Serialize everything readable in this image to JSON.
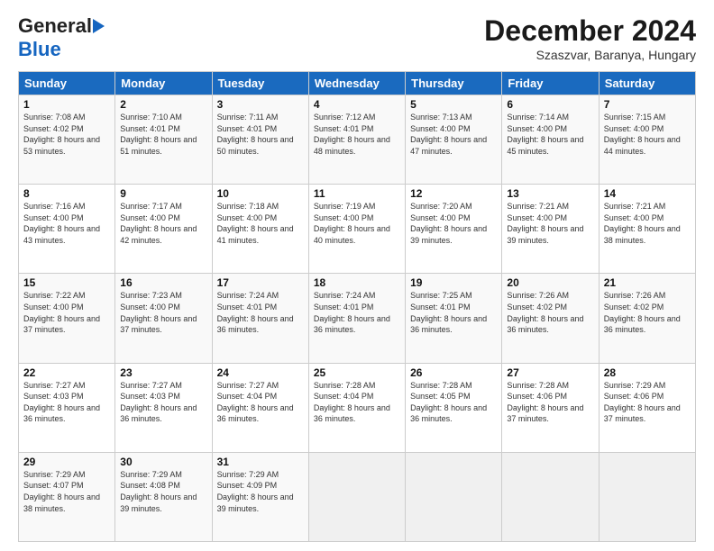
{
  "header": {
    "logo_general": "General",
    "logo_blue": "Blue",
    "month_title": "December 2024",
    "location": "Szaszvar, Baranya, Hungary"
  },
  "days_of_week": [
    "Sunday",
    "Monday",
    "Tuesday",
    "Wednesday",
    "Thursday",
    "Friday",
    "Saturday"
  ],
  "weeks": [
    [
      {
        "day": 1,
        "sunrise": "7:08 AM",
        "sunset": "4:02 PM",
        "daylight": "8 hours and 53 minutes."
      },
      {
        "day": 2,
        "sunrise": "7:10 AM",
        "sunset": "4:01 PM",
        "daylight": "8 hours and 51 minutes."
      },
      {
        "day": 3,
        "sunrise": "7:11 AM",
        "sunset": "4:01 PM",
        "daylight": "8 hours and 50 minutes."
      },
      {
        "day": 4,
        "sunrise": "7:12 AM",
        "sunset": "4:01 PM",
        "daylight": "8 hours and 48 minutes."
      },
      {
        "day": 5,
        "sunrise": "7:13 AM",
        "sunset": "4:00 PM",
        "daylight": "8 hours and 47 minutes."
      },
      {
        "day": 6,
        "sunrise": "7:14 AM",
        "sunset": "4:00 PM",
        "daylight": "8 hours and 45 minutes."
      },
      {
        "day": 7,
        "sunrise": "7:15 AM",
        "sunset": "4:00 PM",
        "daylight": "8 hours and 44 minutes."
      }
    ],
    [
      {
        "day": 8,
        "sunrise": "7:16 AM",
        "sunset": "4:00 PM",
        "daylight": "8 hours and 43 minutes."
      },
      {
        "day": 9,
        "sunrise": "7:17 AM",
        "sunset": "4:00 PM",
        "daylight": "8 hours and 42 minutes."
      },
      {
        "day": 10,
        "sunrise": "7:18 AM",
        "sunset": "4:00 PM",
        "daylight": "8 hours and 41 minutes."
      },
      {
        "day": 11,
        "sunrise": "7:19 AM",
        "sunset": "4:00 PM",
        "daylight": "8 hours and 40 minutes."
      },
      {
        "day": 12,
        "sunrise": "7:20 AM",
        "sunset": "4:00 PM",
        "daylight": "8 hours and 39 minutes."
      },
      {
        "day": 13,
        "sunrise": "7:21 AM",
        "sunset": "4:00 PM",
        "daylight": "8 hours and 39 minutes."
      },
      {
        "day": 14,
        "sunrise": "7:21 AM",
        "sunset": "4:00 PM",
        "daylight": "8 hours and 38 minutes."
      }
    ],
    [
      {
        "day": 15,
        "sunrise": "7:22 AM",
        "sunset": "4:00 PM",
        "daylight": "8 hours and 37 minutes."
      },
      {
        "day": 16,
        "sunrise": "7:23 AM",
        "sunset": "4:00 PM",
        "daylight": "8 hours and 37 minutes."
      },
      {
        "day": 17,
        "sunrise": "7:24 AM",
        "sunset": "4:01 PM",
        "daylight": "8 hours and 36 minutes."
      },
      {
        "day": 18,
        "sunrise": "7:24 AM",
        "sunset": "4:01 PM",
        "daylight": "8 hours and 36 minutes."
      },
      {
        "day": 19,
        "sunrise": "7:25 AM",
        "sunset": "4:01 PM",
        "daylight": "8 hours and 36 minutes."
      },
      {
        "day": 20,
        "sunrise": "7:26 AM",
        "sunset": "4:02 PM",
        "daylight": "8 hours and 36 minutes."
      },
      {
        "day": 21,
        "sunrise": "7:26 AM",
        "sunset": "4:02 PM",
        "daylight": "8 hours and 36 minutes."
      }
    ],
    [
      {
        "day": 22,
        "sunrise": "7:27 AM",
        "sunset": "4:03 PM",
        "daylight": "8 hours and 36 minutes."
      },
      {
        "day": 23,
        "sunrise": "7:27 AM",
        "sunset": "4:03 PM",
        "daylight": "8 hours and 36 minutes."
      },
      {
        "day": 24,
        "sunrise": "7:27 AM",
        "sunset": "4:04 PM",
        "daylight": "8 hours and 36 minutes."
      },
      {
        "day": 25,
        "sunrise": "7:28 AM",
        "sunset": "4:04 PM",
        "daylight": "8 hours and 36 minutes."
      },
      {
        "day": 26,
        "sunrise": "7:28 AM",
        "sunset": "4:05 PM",
        "daylight": "8 hours and 36 minutes."
      },
      {
        "day": 27,
        "sunrise": "7:28 AM",
        "sunset": "4:06 PM",
        "daylight": "8 hours and 37 minutes."
      },
      {
        "day": 28,
        "sunrise": "7:29 AM",
        "sunset": "4:06 PM",
        "daylight": "8 hours and 37 minutes."
      }
    ],
    [
      {
        "day": 29,
        "sunrise": "7:29 AM",
        "sunset": "4:07 PM",
        "daylight": "8 hours and 38 minutes."
      },
      {
        "day": 30,
        "sunrise": "7:29 AM",
        "sunset": "4:08 PM",
        "daylight": "8 hours and 39 minutes."
      },
      {
        "day": 31,
        "sunrise": "7:29 AM",
        "sunset": "4:09 PM",
        "daylight": "8 hours and 39 minutes."
      },
      null,
      null,
      null,
      null
    ]
  ],
  "labels": {
    "sunrise": "Sunrise:",
    "sunset": "Sunset:",
    "daylight": "Daylight:"
  }
}
